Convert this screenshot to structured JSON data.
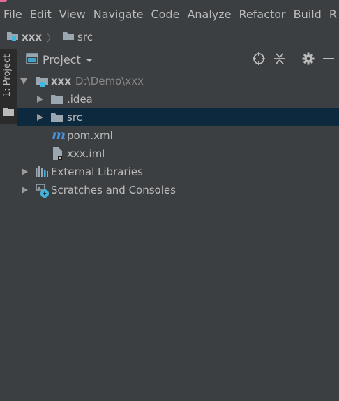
{
  "menu": {
    "items": [
      "File",
      "Edit",
      "View",
      "Navigate",
      "Code",
      "Analyze",
      "Refactor",
      "Build",
      "R"
    ]
  },
  "breadcrumb": {
    "project": "xxx",
    "folder": "src"
  },
  "tool_window_strip": {
    "tab_label": "1: Project"
  },
  "project_panel": {
    "title": "Project",
    "tools": [
      "locate-icon",
      "collapse-all-icon",
      "gear-icon",
      "minimize-icon"
    ]
  },
  "tree": {
    "root": {
      "label": "xxx",
      "path": "D:\\Demo\\xxx"
    },
    "idea": {
      "label": ".idea"
    },
    "src": {
      "label": "src",
      "selected": true
    },
    "pom": {
      "label": "pom.xml"
    },
    "iml": {
      "label": "xxx.iml"
    },
    "external": {
      "label": "External Libraries"
    },
    "scratches": {
      "label": "Scratches and Consoles"
    }
  },
  "colors": {
    "background": "#3c3f41",
    "selection": "#0d293e",
    "folder": "#9aa7b0",
    "module_badge": "#40b6e0",
    "maven_blue": "#4a90d9"
  }
}
